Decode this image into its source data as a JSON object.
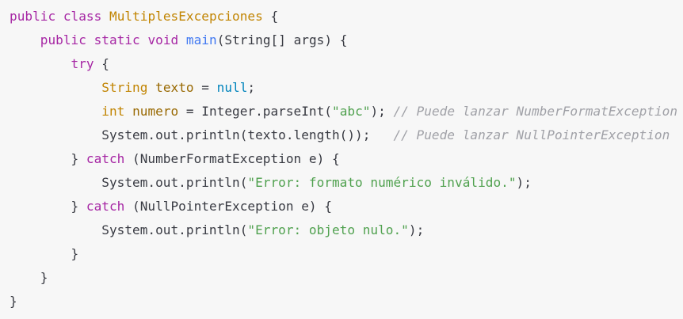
{
  "code": {
    "language": "java",
    "lines": [
      {
        "indent": "",
        "tokens": [
          {
            "t": "kw",
            "v": "public"
          },
          {
            "t": "txt",
            "v": " "
          },
          {
            "t": "kw",
            "v": "class"
          },
          {
            "t": "txt",
            "v": " "
          },
          {
            "t": "cls",
            "v": "MultiplesExcepciones"
          },
          {
            "t": "txt",
            "v": " {"
          }
        ]
      },
      {
        "indent": "    ",
        "tokens": [
          {
            "t": "kw",
            "v": "public"
          },
          {
            "t": "txt",
            "v": " "
          },
          {
            "t": "kw",
            "v": "static"
          },
          {
            "t": "txt",
            "v": " "
          },
          {
            "t": "kw",
            "v": "void"
          },
          {
            "t": "txt",
            "v": " "
          },
          {
            "t": "fn",
            "v": "main"
          },
          {
            "t": "txt",
            "v": "(String[] args) {"
          }
        ]
      },
      {
        "indent": "        ",
        "tokens": [
          {
            "t": "kw",
            "v": "try"
          },
          {
            "t": "txt",
            "v": " {"
          }
        ]
      },
      {
        "indent": "            ",
        "tokens": [
          {
            "t": "cls",
            "v": "String"
          },
          {
            "t": "txt",
            "v": " "
          },
          {
            "t": "id",
            "v": "texto"
          },
          {
            "t": "txt",
            "v": " = "
          },
          {
            "t": "lit",
            "v": "null"
          },
          {
            "t": "txt",
            "v": ";"
          }
        ]
      },
      {
        "indent": "            ",
        "tokens": [
          {
            "t": "cls",
            "v": "int"
          },
          {
            "t": "txt",
            "v": " "
          },
          {
            "t": "id",
            "v": "numero"
          },
          {
            "t": "txt",
            "v": " = Integer.parseInt("
          },
          {
            "t": "str",
            "v": "\"abc\""
          },
          {
            "t": "txt",
            "v": "); "
          },
          {
            "t": "cmt",
            "v": "// Puede lanzar NumberFormatException"
          }
        ]
      },
      {
        "indent": "            ",
        "tokens": [
          {
            "t": "txt",
            "v": "System.out.println(texto.length());   "
          },
          {
            "t": "cmt",
            "v": "// Puede lanzar NullPointerException"
          }
        ]
      },
      {
        "indent": "        ",
        "tokens": [
          {
            "t": "txt",
            "v": "} "
          },
          {
            "t": "kw",
            "v": "catch"
          },
          {
            "t": "txt",
            "v": " (NumberFormatException e) {"
          }
        ]
      },
      {
        "indent": "            ",
        "tokens": [
          {
            "t": "txt",
            "v": "System.out.println("
          },
          {
            "t": "str",
            "v": "\"Error: formato numérico inválido.\""
          },
          {
            "t": "txt",
            "v": ");"
          }
        ]
      },
      {
        "indent": "        ",
        "tokens": [
          {
            "t": "txt",
            "v": "} "
          },
          {
            "t": "kw",
            "v": "catch"
          },
          {
            "t": "txt",
            "v": " (NullPointerException e) {"
          }
        ]
      },
      {
        "indent": "            ",
        "tokens": [
          {
            "t": "txt",
            "v": "System.out.println("
          },
          {
            "t": "str",
            "v": "\"Error: objeto nulo.\""
          },
          {
            "t": "txt",
            "v": ");"
          }
        ]
      },
      {
        "indent": "        ",
        "tokens": [
          {
            "t": "txt",
            "v": "}"
          }
        ]
      },
      {
        "indent": "    ",
        "tokens": [
          {
            "t": "txt",
            "v": "}"
          }
        ]
      },
      {
        "indent": "",
        "tokens": [
          {
            "t": "txt",
            "v": "}"
          }
        ]
      }
    ]
  },
  "colors": {
    "background": "#f7f7f7",
    "keyword": "#a626a4",
    "type": "#c18401",
    "function": "#4078f2",
    "string": "#50a14f",
    "literal": "#0184bc",
    "identifier": "#986801",
    "text": "#383a42",
    "comment": "#a0a1a7"
  }
}
